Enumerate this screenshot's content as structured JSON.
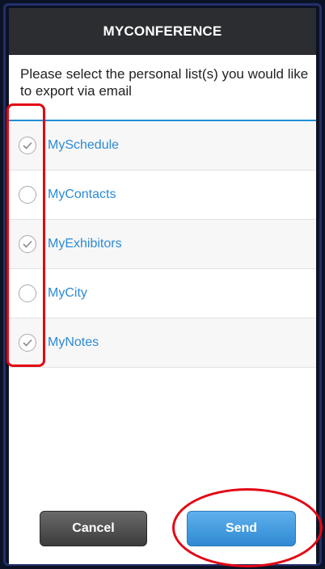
{
  "header": {
    "title": "MYCONFERENCE"
  },
  "instructions": "Please select the personal list(s) you would like to export via email",
  "lists": [
    {
      "label": "MySchedule",
      "checked": true
    },
    {
      "label": "MyContacts",
      "checked": false
    },
    {
      "label": "MyExhibitors",
      "checked": true
    },
    {
      "label": "MyCity",
      "checked": false
    },
    {
      "label": "MyNotes",
      "checked": true
    }
  ],
  "buttons": {
    "cancel": "Cancel",
    "send": "Send"
  },
  "colors": {
    "header_bg": "#2b2d31",
    "accent": "#2c8ad6",
    "annotation": "#e30613"
  }
}
